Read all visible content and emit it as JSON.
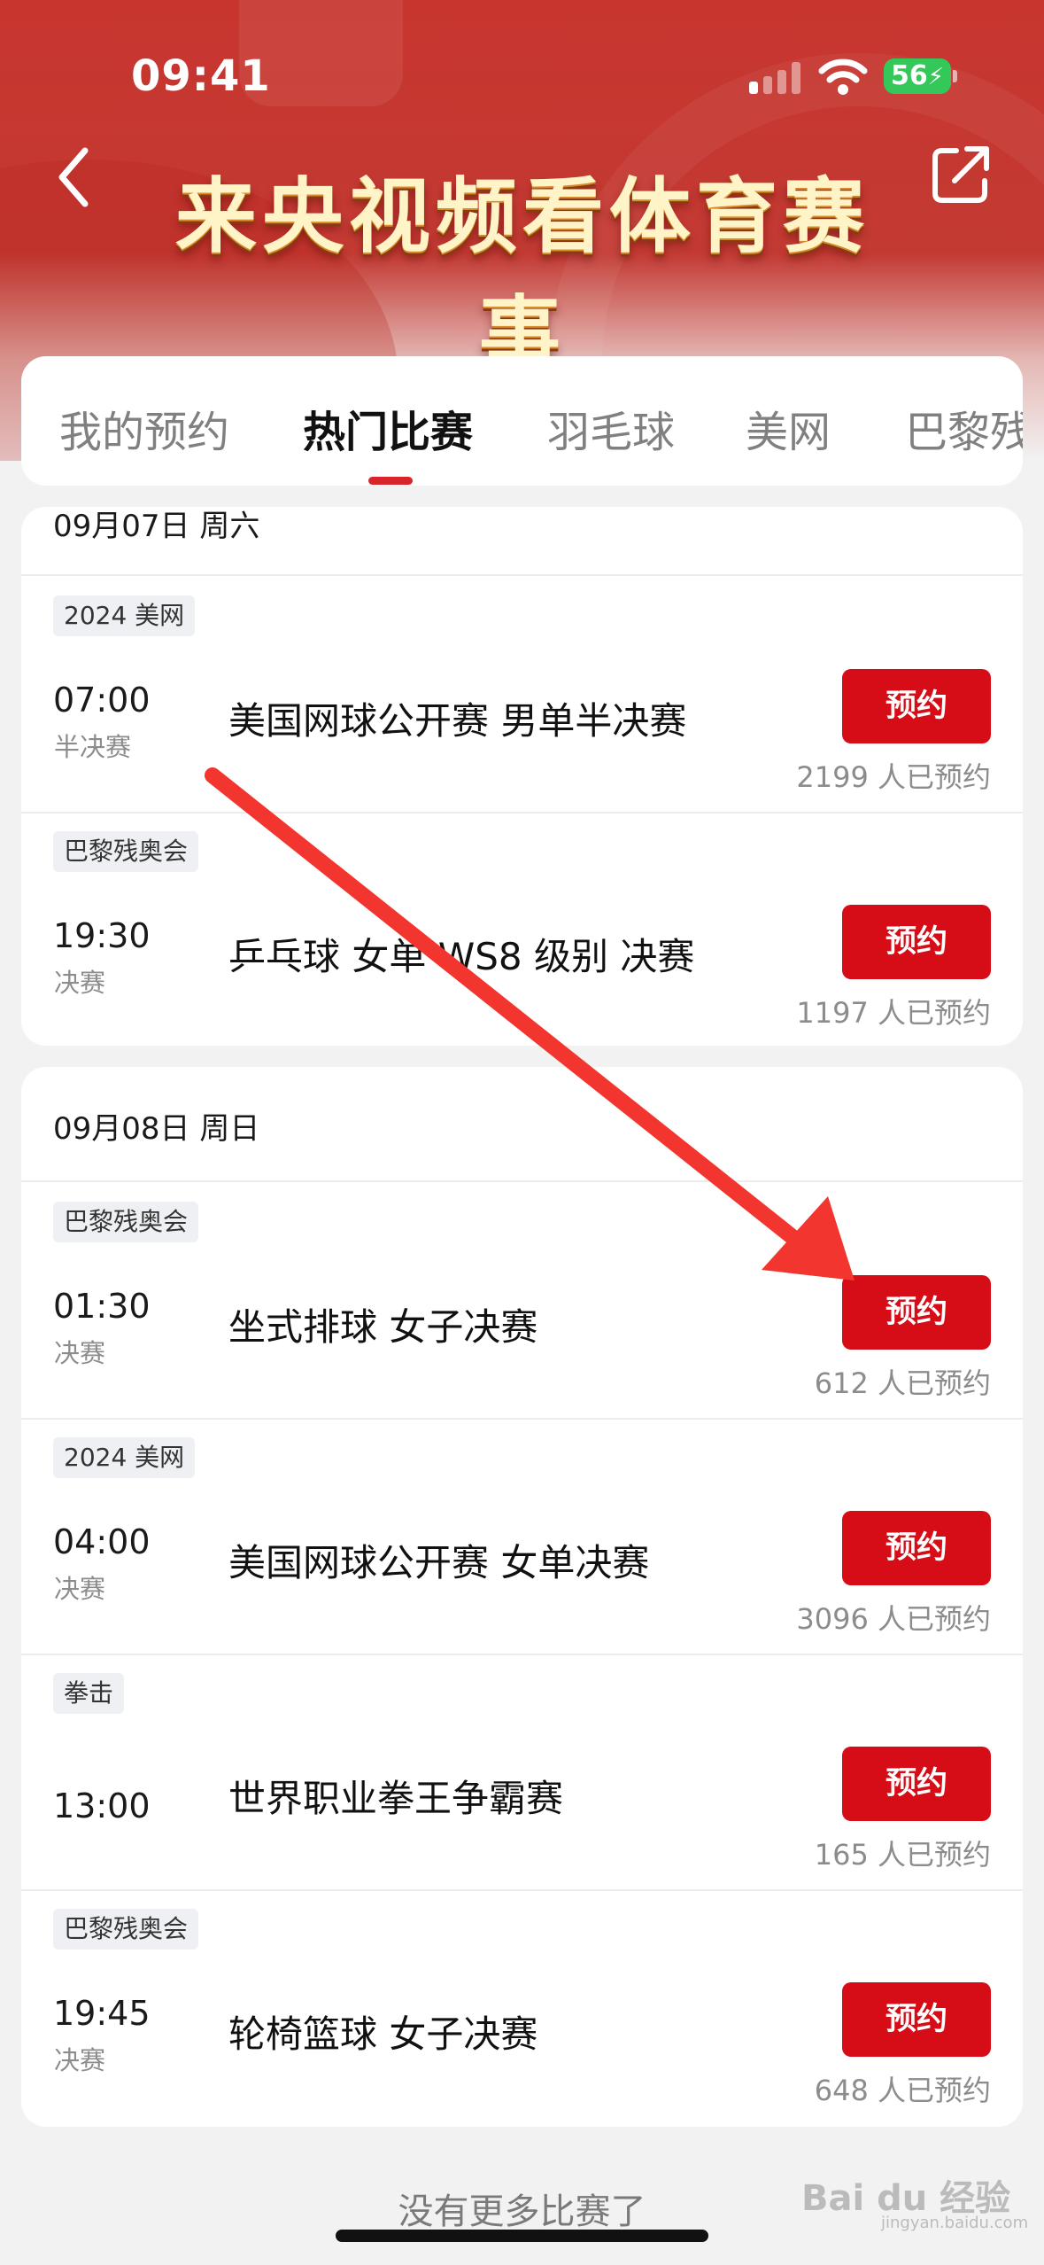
{
  "status": {
    "time": "09:41",
    "battery": "56"
  },
  "header": {
    "title": "来央视频看体育赛事"
  },
  "tabs": [
    {
      "label": "我的预约"
    },
    {
      "label": "热门比赛"
    },
    {
      "label": "羽毛球"
    },
    {
      "label": "美网"
    },
    {
      "label": "巴黎残"
    }
  ],
  "days": [
    {
      "date": "09月07日 周六",
      "matches": [
        {
          "tag": "2024 美网",
          "time": "07:00",
          "stage": "半决赛",
          "title": "美国网球公开赛 男单半决赛",
          "button": "预约",
          "count": "2199 人已预约"
        },
        {
          "tag": "巴黎残奥会",
          "time": "19:30",
          "stage": "决赛",
          "title": "乒乓球 女单 WS8 级别 决赛",
          "button": "预约",
          "count": "1197 人已预约"
        }
      ]
    },
    {
      "date": "09月08日 周日",
      "matches": [
        {
          "tag": "巴黎残奥会",
          "time": "01:30",
          "stage": "决赛",
          "title": "坐式排球 女子决赛",
          "button": "预约",
          "count": "612 人已预约"
        },
        {
          "tag": "2024 美网",
          "time": "04:00",
          "stage": "决赛",
          "title": "美国网球公开赛 女单决赛",
          "button": "预约",
          "count": "3096 人已预约"
        },
        {
          "tag": "拳击",
          "time": "13:00",
          "stage": "",
          "title": "世界职业拳王争霸赛",
          "button": "预约",
          "count": "165 人已预约"
        },
        {
          "tag": "巴黎残奥会",
          "time": "19:45",
          "stage": "决赛",
          "title": "轮椅篮球 女子决赛",
          "button": "预约",
          "count": "648 人已预约"
        }
      ]
    }
  ],
  "footer": {
    "no_more": "没有更多比赛了"
  },
  "watermark": {
    "brand": "Bai du 经验",
    "url": "jingyan.baidu.com"
  },
  "colors": {
    "accent": "#d60d17",
    "header_red": "#c8352f",
    "arrow": "#f2352e"
  }
}
